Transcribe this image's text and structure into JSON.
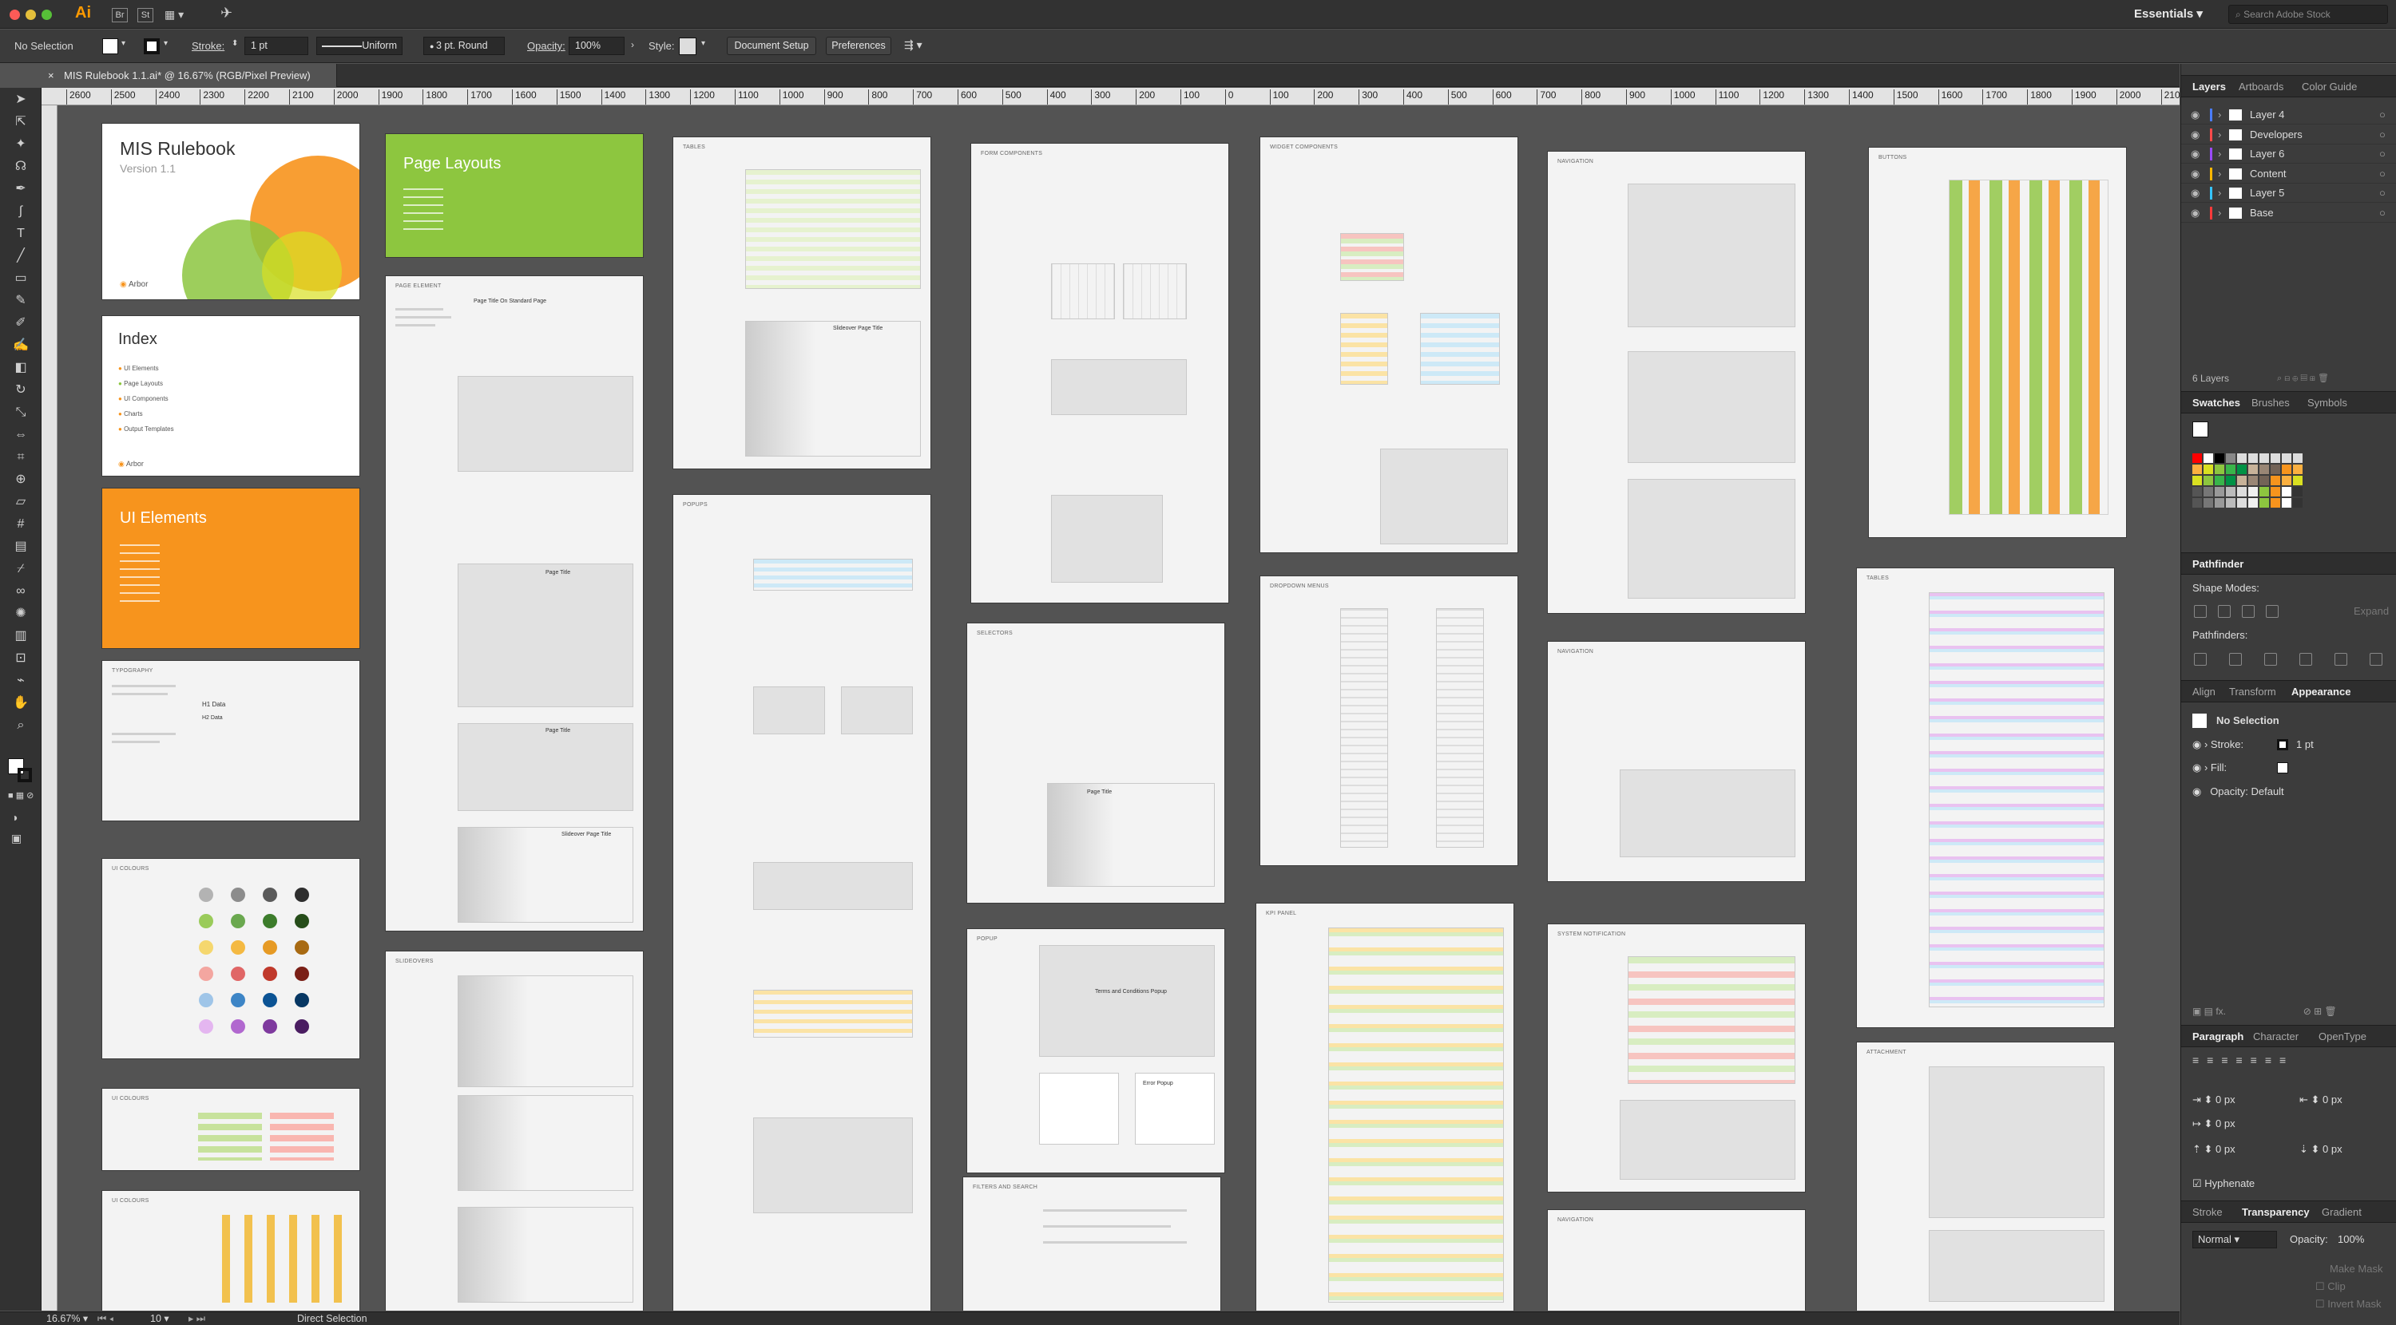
{
  "app": {
    "logo": "Ai",
    "workspace": "Essentials",
    "search_placeholder": "Search Adobe Stock",
    "menu_icons": [
      "Br",
      "St"
    ]
  },
  "control_bar": {
    "selection": "No Selection",
    "stroke_label": "Stroke:",
    "stroke_value": "1 pt",
    "stroke_profile": "Uniform",
    "brush": "3 pt. Round",
    "opacity_label": "Opacity:",
    "opacity_value": "100%",
    "style_label": "Style:",
    "document_setup": "Document Setup",
    "preferences": "Preferences"
  },
  "document": {
    "tab_title": "MIS Rulebook 1.1.ai* @ 16.67% (RGB/Pixel Preview)"
  },
  "ruler": {
    "ticks": [
      "2600",
      "2500",
      "2400",
      "2300",
      "2200",
      "2100",
      "2000",
      "1900",
      "1800",
      "1700",
      "1600",
      "1500",
      "1400",
      "1300",
      "1200",
      "1100",
      "1000",
      "900",
      "800",
      "700",
      "600",
      "500",
      "400",
      "300",
      "200",
      "100",
      "0",
      "100",
      "200",
      "300",
      "400",
      "500",
      "600",
      "700",
      "800",
      "900",
      "1000",
      "1100",
      "1200",
      "1300",
      "1400",
      "1500",
      "1600",
      "1700",
      "1800",
      "1900",
      "2000",
      "210"
    ]
  },
  "artboards": {
    "cover": {
      "title": "MIS Rulebook",
      "version": "Version 1.1",
      "brand": "Arbor"
    },
    "index": {
      "title": "Index",
      "items": [
        "UI Elements",
        "Page Layouts",
        "UI Components",
        "Charts",
        "Output Templates"
      ],
      "brand": "Arbor"
    },
    "ui_elements": {
      "title": "UI Elements"
    },
    "page_layouts": {
      "title": "Page Layouts"
    },
    "headings": [
      "TYPOGRAPHY",
      "UI COLOURS",
      "UI COLOURS",
      "UI COLOURS",
      "PAGE ELEMENT",
      "SLIDEOVERS",
      "TABLES",
      "POPUPS",
      "FORM COMPONENTS",
      "SELECTORS",
      "POPUP",
      "FILTERS AND SEARCH",
      "WIDGET COMPONENTS",
      "DROPDOWN MENUS",
      "KPI PANEL",
      "NAVIGATION",
      "NAVIGATION",
      "SYSTEM NOTIFICATION",
      "NAVIGATION",
      "BUTTONS",
      "TABLES",
      "ATTACHMENT"
    ],
    "typo_samples": [
      "H1 Data",
      "H2 Data"
    ],
    "page_title_samples": [
      "Page Title On Standard Page",
      "Page Title",
      "Page Title",
      "Slideover Page Title",
      "Page Title",
      "Slideover Page Title",
      "Terms and Conditions Popup",
      "Error Popup"
    ]
  },
  "status": {
    "zoom": "16.67%",
    "artboard_num": "10",
    "tool": "Direct Selection"
  },
  "panels": {
    "layers_tabs": [
      "Layers",
      "Artboards",
      "Color Guide"
    ],
    "layers": [
      {
        "name": "Layer 4",
        "color": "#4a7cff"
      },
      {
        "name": "Developers",
        "color": "#ff4a4a"
      },
      {
        "name": "Layer 6",
        "color": "#9a4aff"
      },
      {
        "name": "Content",
        "color": "#ffb700"
      },
      {
        "name": "Layer 5",
        "color": "#35c4ff"
      },
      {
        "name": "Base",
        "color": "#ff3a3a"
      }
    ],
    "layer_count": "6 Layers",
    "swatch_tabs": [
      "Swatches",
      "Brushes",
      "Symbols"
    ],
    "pathfinder": {
      "title": "Pathfinder",
      "shape_modes": "Shape Modes:",
      "pathfinders": "Pathfinders:",
      "expand": "Expand"
    },
    "appearance_tabs": [
      "Align",
      "Transform",
      "Appearance"
    ],
    "appearance": {
      "selection": "No Selection",
      "stroke": "Stroke:",
      "stroke_value": "1 pt",
      "fill": "Fill:",
      "opacity": "Opacity: Default"
    },
    "paragraph_tabs": [
      "Paragraph",
      "Character",
      "OpenType"
    ],
    "paragraph": {
      "values": [
        "0 px",
        "0 px",
        "0 px",
        "0 px",
        "0 px"
      ],
      "hyphenate": "Hyphenate"
    },
    "transparency_tabs": [
      "Stroke",
      "Transparency",
      "Gradient"
    ],
    "transparency": {
      "mode": "Normal",
      "opacity_label": "Opacity:",
      "opacity_value": "100%",
      "make_mask": "Make Mask",
      "clip": "Clip",
      "invert": "Invert Mask"
    }
  }
}
